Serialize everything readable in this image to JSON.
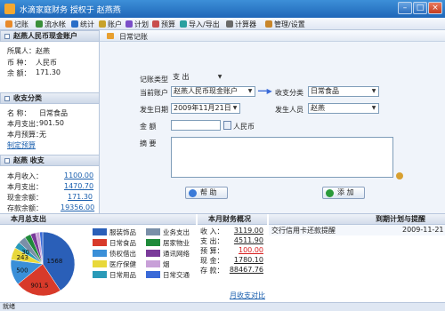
{
  "window": {
    "title": "水滴家庭财务  授权于  赵燕燕"
  },
  "toolbar": [
    {
      "label": "记账",
      "color": "#e88a2a"
    },
    {
      "label": "流水帐",
      "color": "#3a8f3a"
    },
    {
      "label": "统计",
      "color": "#2a6ec8"
    },
    {
      "label": "账户",
      "color": "#c8a22a"
    },
    {
      "label": "计划",
      "color": "#7a4ec8"
    },
    {
      "label": "预算",
      "color": "#c84e4e"
    },
    {
      "label": "导入/导出",
      "color": "#2aa0a0"
    },
    {
      "label": "计算器",
      "color": "#6a6a6a"
    },
    {
      "label": "管理/设置",
      "color": "#c8862a"
    }
  ],
  "account": {
    "title": "赵燕人民币现金账户",
    "owner_label": "所属人：",
    "owner": "赵燕",
    "currency_label": "币    种：",
    "currency": "人民币",
    "balance_label": "余    额：",
    "balance": "171.30"
  },
  "category": {
    "title": "收支分类",
    "name_label": "名    称：",
    "name": "日常食品",
    "month_expense_label": "本月支出：",
    "month_expense": "901.50",
    "month_budget_label": "本月预算：",
    "month_budget": "无",
    "set_budget_link": "制定预算"
  },
  "income": {
    "title": "赵燕  收支",
    "rows": [
      {
        "label": "本月收入：",
        "value": "1100.00"
      },
      {
        "label": "本月支出：",
        "value": "1470.70"
      },
      {
        "label": "现金余额：",
        "value": "171.30"
      },
      {
        "label": "存款余额：",
        "value": "19356.00"
      }
    ]
  },
  "form": {
    "tab": "日常记账",
    "type_label": "记账类型",
    "type_value": "支 出",
    "account_label": "当前账户",
    "account_value": "赵燕人民币现金账户",
    "category_label": "收支分类",
    "category_value": "日常食品",
    "date_label": "发生日期",
    "date_value": "2009年11月21日",
    "person_label": "发生人员",
    "person_value": "赵燕",
    "amount_label": "金    额",
    "amount_value": "",
    "amount_unit": "人民币",
    "memo_label": "摘    要",
    "memo_value": "",
    "help_button": "帮 助",
    "add_button": "添 加"
  },
  "expense_panel": {
    "title": "本月总支出",
    "legend": [
      {
        "label": "服装饰品",
        "color": "#2a5fb8"
      },
      {
        "label": "业务支出",
        "color": "#7a8fa8"
      },
      {
        "label": "日常食品",
        "color": "#d83a2a"
      },
      {
        "label": "居家物业",
        "color": "#1f8a3a"
      },
      {
        "label": "债权借出",
        "color": "#3a8fd8"
      },
      {
        "label": "通讯网络",
        "color": "#7a3a9a"
      },
      {
        "label": "医疗保健",
        "color": "#e8d83a"
      },
      {
        "label": "烟",
        "color": "#c8a0d8"
      },
      {
        "label": "日常用品",
        "color": "#2a9ab8"
      },
      {
        "label": "日常交通",
        "color": "#3a6ad8"
      }
    ]
  },
  "chart_data": {
    "type": "pie",
    "slices": [
      {
        "label": "服装饰品",
        "value": 1568,
        "color": "#2a5fb8"
      },
      {
        "label": "日常食品",
        "value": 901.5,
        "color": "#d83a2a"
      },
      {
        "label": "债权借出",
        "value": 500,
        "color": "#3a8fd8"
      },
      {
        "label": "医疗保健",
        "value": 243,
        "color": "#e8d83a"
      },
      {
        "label": "日常用品",
        "value": 130,
        "color": "#2a9ab8"
      },
      {
        "label": "业务支出",
        "value": 150,
        "color": "#7a8fa8"
      },
      {
        "label": "居家物业",
        "value": 120,
        "color": "#1f8a3a"
      },
      {
        "label": "通讯网络",
        "value": 100,
        "color": "#7a3a9a"
      },
      {
        "label": "烟",
        "value": 80,
        "color": "#c8a0d8"
      },
      {
        "label": "日常交通",
        "value": 60,
        "color": "#3a6ad8"
      }
    ],
    "data_labels": [
      "1568",
      "901.5",
      "500",
      "243",
      "30"
    ]
  },
  "finance": {
    "title": "本月财务概况",
    "rows": [
      {
        "label": "收  入：",
        "value": "3119.00",
        "color": "#222222"
      },
      {
        "label": "支  出：",
        "value": "4511.90",
        "color": "#222222"
      },
      {
        "label": "预  算：",
        "value": "100.00",
        "color": "#d82020"
      },
      {
        "label": "现  金：",
        "value": "1780.10",
        "color": "#222222"
      },
      {
        "label": "存  款：",
        "value": "88467.76",
        "color": "#222222"
      }
    ],
    "compare_link": "月收支对比"
  },
  "reminder": {
    "title": "到期计划与提醒",
    "item_text": "交行信用卡还款提醒",
    "item_date": "2009-11-21"
  },
  "status": {
    "text": "就绪"
  }
}
